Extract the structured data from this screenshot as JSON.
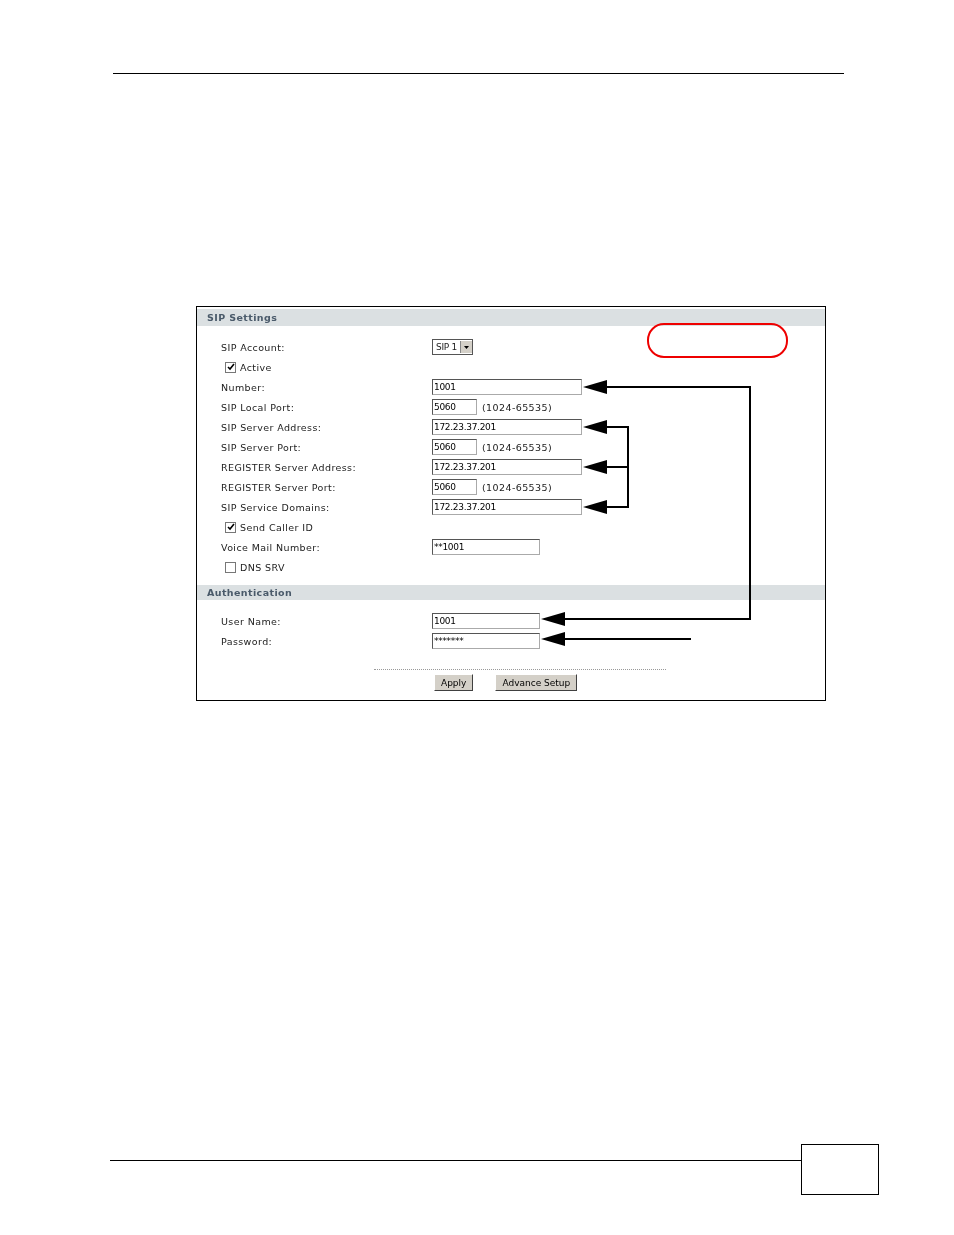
{
  "sip_settings": {
    "title": "SIP Settings",
    "rows": [
      {
        "kind": "select",
        "label": "SIP Account:",
        "value": "SIP 1"
      },
      {
        "kind": "checkbox",
        "label": "Active",
        "checked": true
      },
      {
        "kind": "wide",
        "label": "Number:",
        "value": "1001"
      },
      {
        "kind": "port",
        "label": "SIP Local Port:",
        "value": "5060",
        "hint": "(1024-65535)"
      },
      {
        "kind": "wide",
        "label": "SIP Server Address:",
        "value": "172.23.37.201"
      },
      {
        "kind": "port",
        "label": "SIP Server Port:",
        "value": "5060",
        "hint": "(1024-65535)"
      },
      {
        "kind": "wide",
        "label": "REGISTER Server Address:",
        "value": "172.23.37.201"
      },
      {
        "kind": "port",
        "label": "REGISTER Server Port:",
        "value": "5060",
        "hint": "(1024-65535)"
      },
      {
        "kind": "wide",
        "label": "SIP Service Domains:",
        "value": "172.23.37.201"
      },
      {
        "kind": "checkbox",
        "label": "Send Caller ID",
        "checked": true
      },
      {
        "kind": "medium",
        "label": "Voice Mail Number:",
        "value": "**1001"
      },
      {
        "kind": "checkbox",
        "label": "DNS SRV",
        "checked": false
      }
    ]
  },
  "authentication": {
    "title": "Authentication",
    "rows": [
      {
        "kind": "medium",
        "label": "User Name:",
        "value": "1001"
      },
      {
        "kind": "medium",
        "label": "Password:",
        "value": "*******"
      }
    ]
  },
  "buttons": [
    "Apply",
    "Advance Setup"
  ]
}
